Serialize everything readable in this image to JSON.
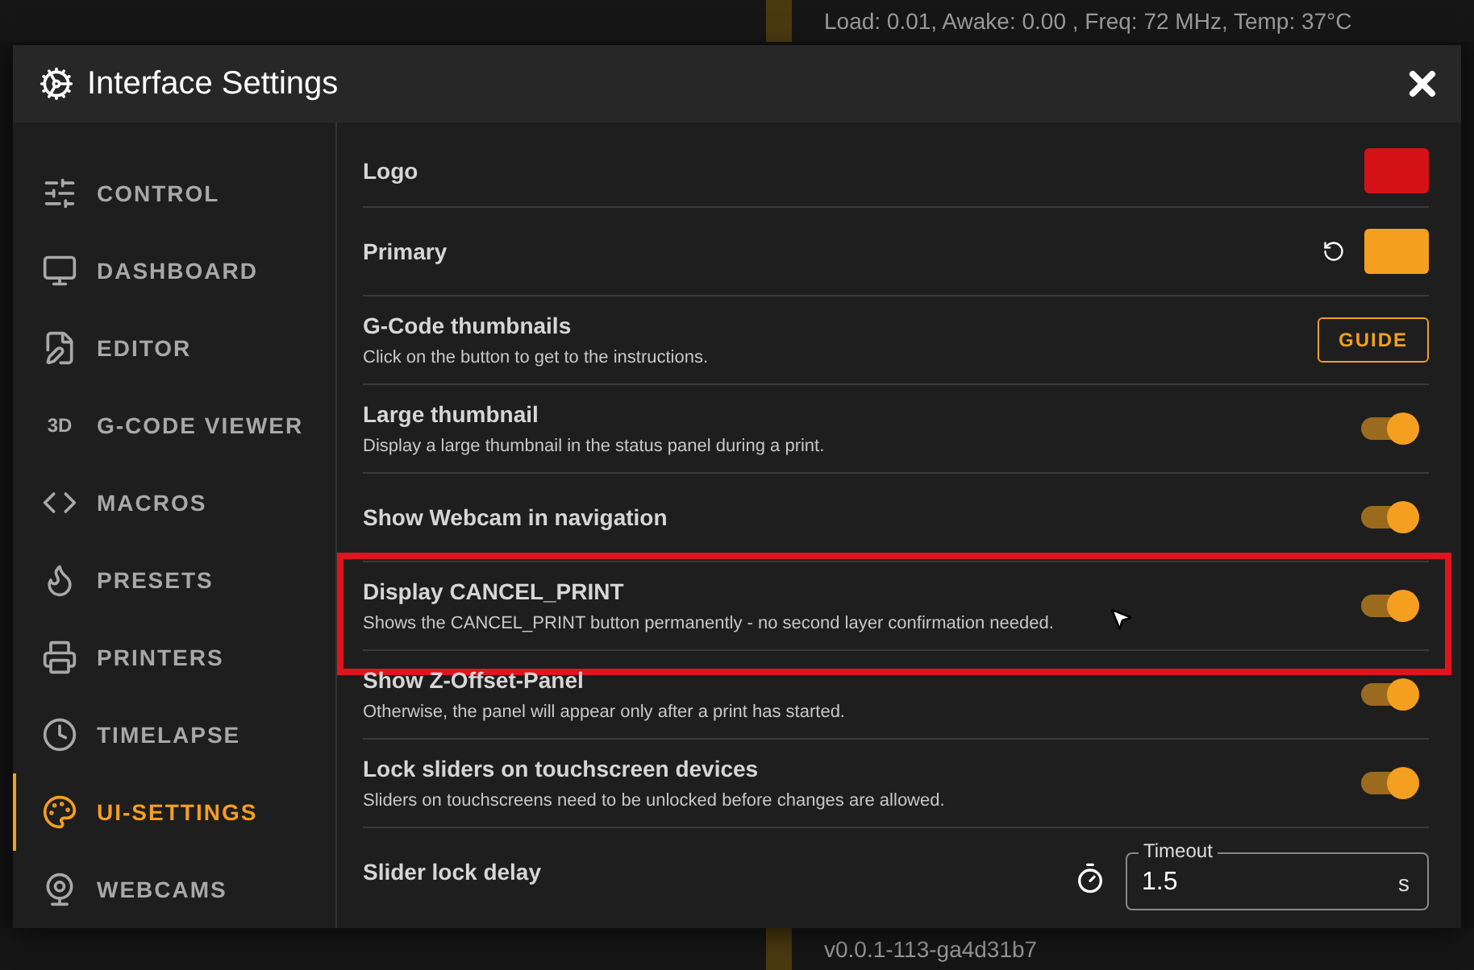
{
  "status_text": "Load: 0.01, Awake: 0.00 , Freq: 72 MHz, Temp: 37°C",
  "version_text": "v0.0.1-113-ga4d31b7",
  "dialog": {
    "title": "Interface Settings"
  },
  "sidebar": {
    "items": [
      {
        "label": "CONTROL",
        "selected": false
      },
      {
        "label": "DASHBOARD",
        "selected": false
      },
      {
        "label": "EDITOR",
        "selected": false
      },
      {
        "label": "G-CODE VIEWER",
        "selected": false,
        "icon_text": "3D"
      },
      {
        "label": "MACROS",
        "selected": false
      },
      {
        "label": "PRESETS",
        "selected": false
      },
      {
        "label": "PRINTERS",
        "selected": false
      },
      {
        "label": "TIMELAPSE",
        "selected": false
      },
      {
        "label": "UI-SETTINGS",
        "selected": true
      },
      {
        "label": "WEBCAMS",
        "selected": false
      }
    ]
  },
  "settings": [
    {
      "kind": "color",
      "title": "Logo",
      "color": "#d41216"
    },
    {
      "kind": "color",
      "title": "Primary",
      "color": "#f59f20",
      "resettable": true
    },
    {
      "kind": "button",
      "title": "G-Code thumbnails",
      "description": "Click on the button to get to the instructions.",
      "button": "GUIDE"
    },
    {
      "kind": "toggle",
      "title": "Large thumbnail",
      "description": "Display a large thumbnail in the status panel during a print.",
      "on": true
    },
    {
      "kind": "toggle",
      "title": "Show Webcam in navigation",
      "on": true
    },
    {
      "kind": "toggle",
      "title": "Display CANCEL_PRINT",
      "description": "Shows the CANCEL_PRINT button permanently - no second layer confirmation needed.",
      "on": true,
      "highlighted": true
    },
    {
      "kind": "toggle",
      "title": "Show Z-Offset-Panel",
      "description": "Otherwise, the panel will appear only after a print has started.",
      "on": true
    },
    {
      "kind": "toggle",
      "title": "Lock sliders on touchscreen devices",
      "description": "Sliders on touchscreens need to be unlocked before changes are allowed.",
      "on": true
    },
    {
      "kind": "number",
      "title": "Slider lock delay",
      "field_label": "Timeout",
      "value": "1.5",
      "suffix": "s"
    }
  ]
}
